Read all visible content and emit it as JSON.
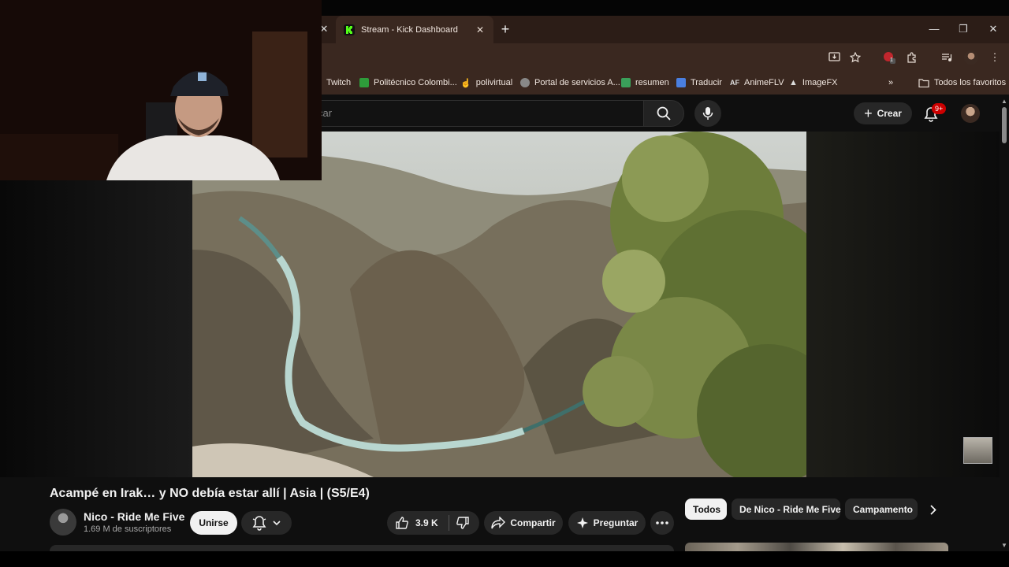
{
  "browser": {
    "active_tab": {
      "title": "Stream - Kick Dashboard",
      "favicon": "kick-icon"
    },
    "new_tab": "+",
    "window_controls": {
      "minimize": "—",
      "restore": "❐",
      "close": "✕"
    },
    "extension_badge": "1"
  },
  "bookmarks": [
    {
      "label": "Twitch"
    },
    {
      "label": "Politécnico Colombi..."
    },
    {
      "label": "polivirtual"
    },
    {
      "label": "Portal de servicios A..."
    },
    {
      "label": "resumen"
    },
    {
      "label": "Traducir"
    },
    {
      "label": "AnimeFLV"
    },
    {
      "label": "ImageFX"
    },
    {
      "label": "Todos los favoritos"
    }
  ],
  "youtube": {
    "search_placeholder": "car",
    "create_label": "Crear",
    "notifications": "9+"
  },
  "video": {
    "title": "Acampé en Irak… y NO debía estar allí | Asia | (S5/E4)",
    "channel_name": "Nico - Ride Me Five",
    "subscribers": "1.69 M de suscriptores",
    "join_label": "Unirse",
    "likes": "3.9 K",
    "share_label": "Compartir",
    "ask_label": "Preguntar"
  },
  "chips": [
    "Todos",
    "De Nico - Ride Me Five",
    "Campamento"
  ],
  "colors": {
    "youtube_bg": "#0f0f0f",
    "chrome_tab": "#3a2820",
    "kick_green": "#53fc18",
    "notif_red": "#cc0000"
  }
}
